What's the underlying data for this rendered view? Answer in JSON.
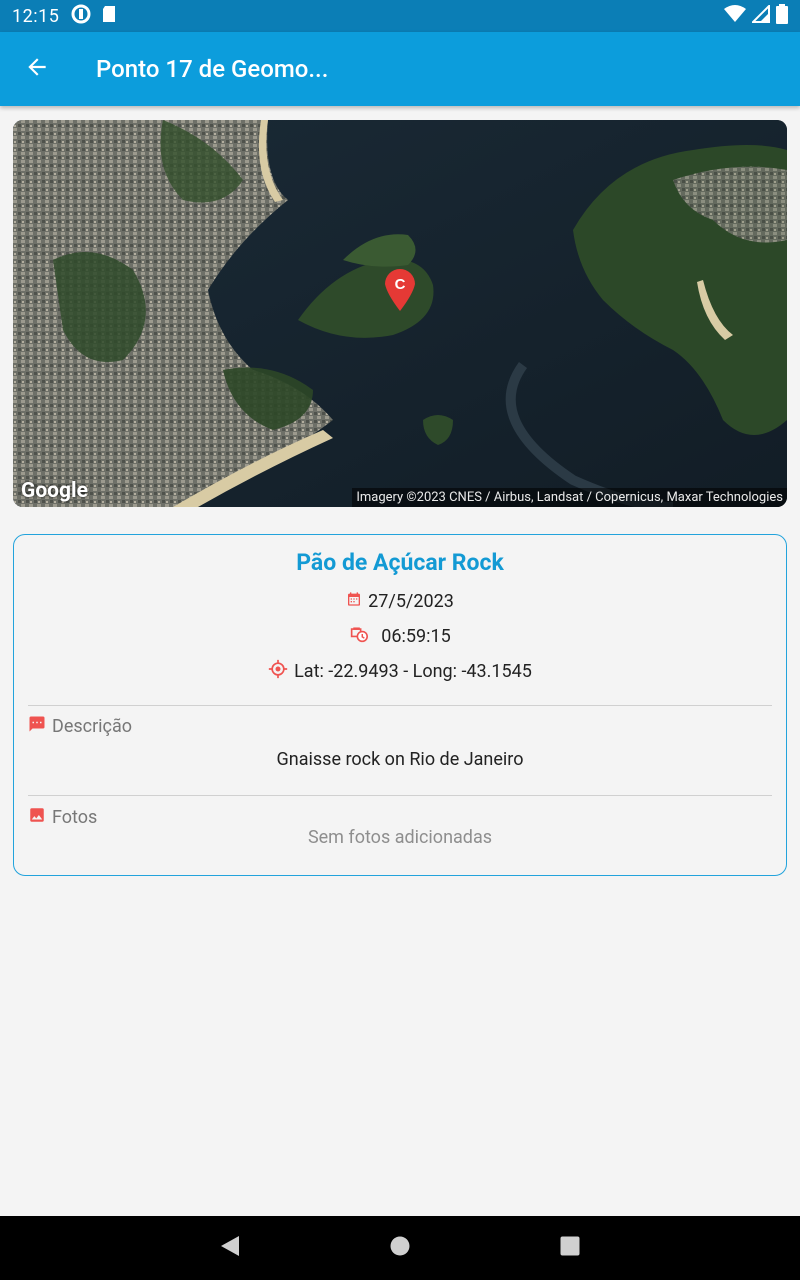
{
  "status_bar": {
    "time": "12:15",
    "icons": [
      "data-saver-icon",
      "sd-card-icon",
      "wifi-icon",
      "signal-icon",
      "battery-icon"
    ]
  },
  "app_bar": {
    "title": "Ponto 17 de Geomo...",
    "back_icon": "arrow-back-icon",
    "color": "#0c9ddc"
  },
  "map": {
    "logo": "Google",
    "attribution": "Imagery ©2023 CNES / Airbus, Landsat / Copernicus, Maxar Technologies",
    "marker_label": "C",
    "marker_color": "#e53935"
  },
  "details": {
    "title": "Pão de Açúcar Rock",
    "date": "27/5/2023",
    "time": "06:59:15",
    "coordinates": "Lat: -22.9493 - Long: -43.1545",
    "description_label": "Descrição",
    "description": "Gnaisse rock on Rio de Janeiro",
    "photos_label": "Fotos",
    "photos_empty": "Sem fotos adicionadas",
    "accent_color": "#139ad4",
    "icon_color": "#ef5350"
  },
  "nav_bar": {
    "buttons": [
      "back-triangle-icon",
      "home-circle-icon",
      "recents-square-icon"
    ]
  }
}
